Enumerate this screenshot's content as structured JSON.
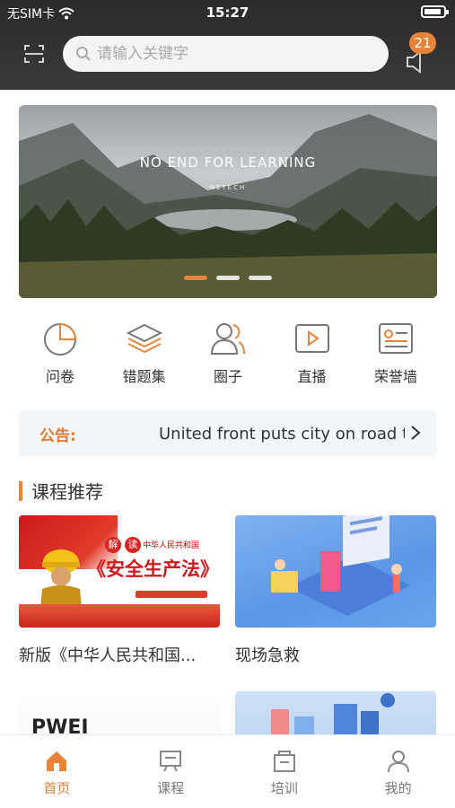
{
  "status_bar": {
    "carrier": "无SIM卡",
    "time": "15:27"
  },
  "header": {
    "search_placeholder": "请输入关键字",
    "notification_count": "21"
  },
  "banner": {
    "title": "NO END FOR LEARNING",
    "subtitle": "NETECH",
    "slide_count": 3,
    "active_slide": 1
  },
  "quick_menu": [
    {
      "label": "问卷",
      "icon": "pie-chart-icon"
    },
    {
      "label": "错题集",
      "icon": "layers-icon"
    },
    {
      "label": "圈子",
      "icon": "group-icon"
    },
    {
      "label": "直播",
      "icon": "play-icon"
    },
    {
      "label": "荣誉墙",
      "icon": "id-card-icon"
    }
  ],
  "announcement": {
    "tag": "公告:",
    "text": "United front puts city on road to"
  },
  "courses_section": {
    "title": "课程推荐",
    "items": [
      {
        "title": "新版《中华人民共和国...",
        "thumb": {
          "jie": "解",
          "du": "读",
          "law_name": "中华人民共和国",
          "headline": "《安全生产法》"
        }
      },
      {
        "title": "现场急救"
      },
      {
        "title": "",
        "thumb_text": "PWEI"
      },
      {
        "title": ""
      }
    ]
  },
  "tabbar": [
    {
      "label": "首页",
      "icon": "home-icon",
      "active": true
    },
    {
      "label": "课程",
      "icon": "course-board-icon",
      "active": false
    },
    {
      "label": "培训",
      "icon": "training-box-icon",
      "active": false
    },
    {
      "label": "我的",
      "icon": "user-icon",
      "active": false
    }
  ],
  "colors": {
    "accent": "#e8833a",
    "header_bg": "#333333",
    "announce_bg": "#f3f6f8"
  }
}
